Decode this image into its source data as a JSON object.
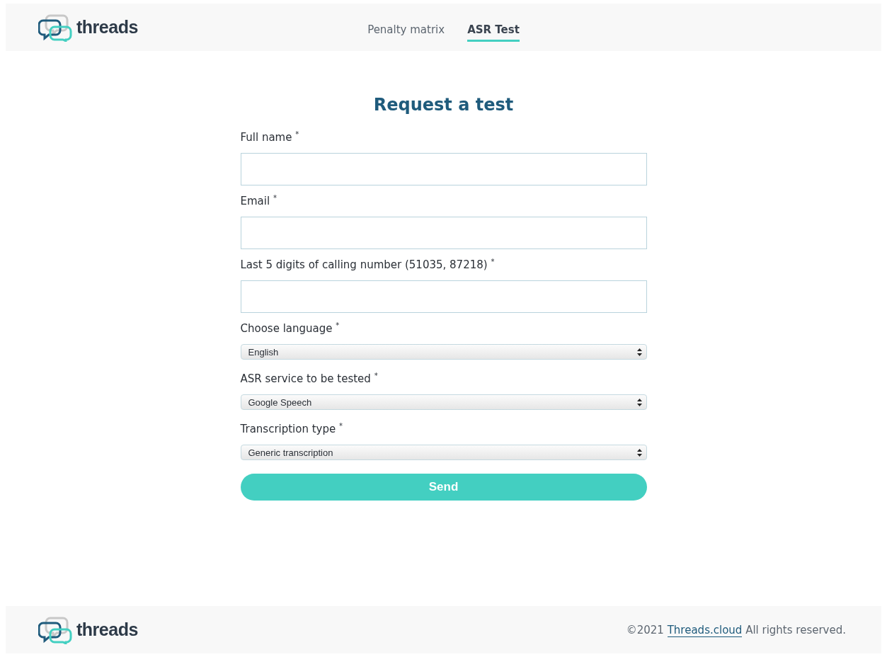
{
  "header": {
    "logo_text": "threads",
    "nav": [
      {
        "label": "Penalty matrix",
        "selected": false
      },
      {
        "label": "ASR Test",
        "selected": true
      }
    ]
  },
  "form": {
    "title": "Request a test",
    "fields": [
      {
        "kind": "text",
        "label": "Full name $^{*}$"
      },
      {
        "kind": "text",
        "label": "Email $^{*}$"
      },
      {
        "kind": "text",
        "label": "Last 5 digits of calling number (51035, 87218) $^{*}$"
      },
      {
        "kind": "select",
        "label": "Choose language $^{*}$",
        "value": "English"
      },
      {
        "kind": "select",
        "label": "ASR service to be tested $^{*}$",
        "value": "Google Speech"
      },
      {
        "kind": "select",
        "label": "Transcription type $^{*}$",
        "value": "Generic transcription"
      }
    ],
    "submit": "Send"
  },
  "footer": {
    "logo_text": "threads",
    "copyright": "©2021",
    "link": "Threads.cloud",
    "rights": "All rights reserved."
  }
}
